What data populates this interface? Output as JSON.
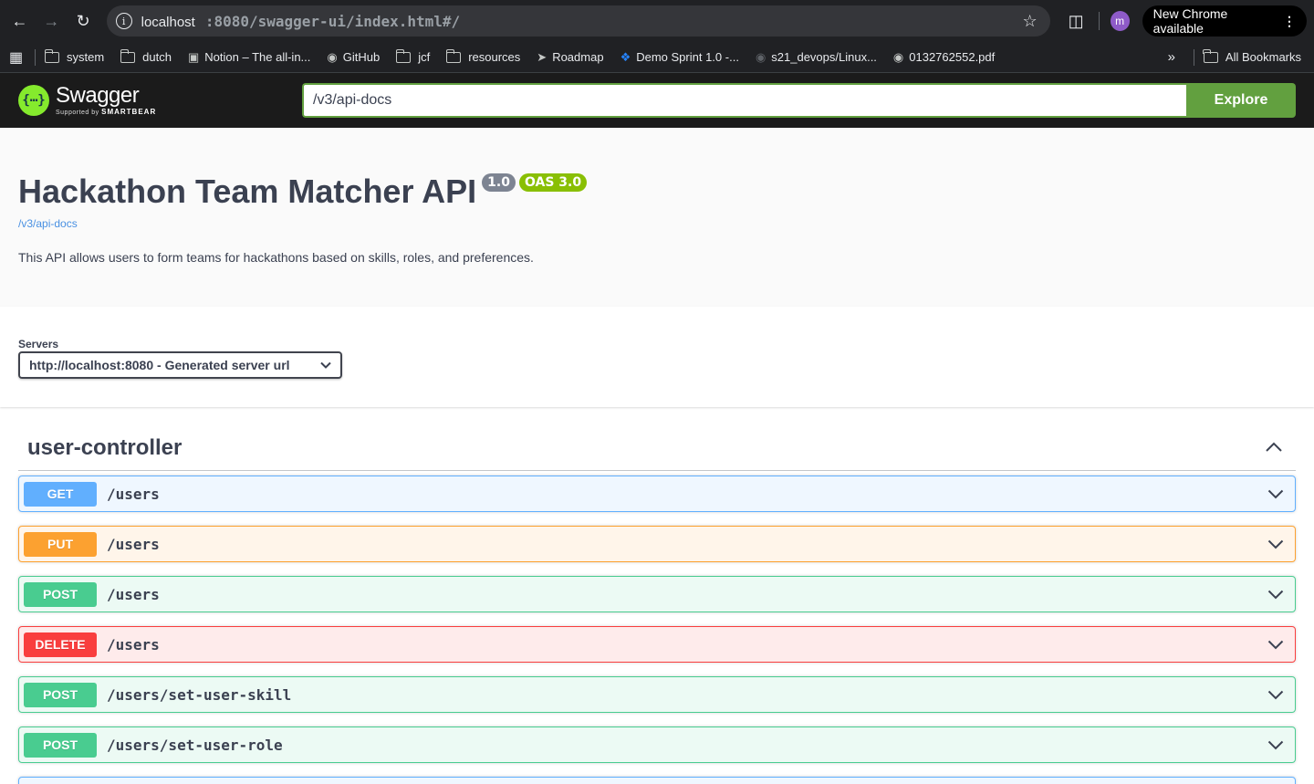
{
  "browser": {
    "url_host": "localhost",
    "url_path": ":8080/swagger-ui/index.html#/",
    "update_label": "New Chrome available",
    "profile_initial": "m"
  },
  "bookmarks": {
    "items": [
      {
        "label": "system",
        "icon": "folder-icon"
      },
      {
        "label": "dutch",
        "icon": "folder-icon"
      },
      {
        "label": "Notion – The all-in...",
        "icon": "notion-icon"
      },
      {
        "label": "GitHub",
        "icon": "github-icon"
      },
      {
        "label": "jcf",
        "icon": "folder-icon"
      },
      {
        "label": "resources",
        "icon": "folder-icon"
      },
      {
        "label": "Roadmap",
        "icon": "rocket-icon"
      },
      {
        "label": "Demo Sprint 1.0 -...",
        "icon": "jira-icon"
      },
      {
        "label": "s21_devops/Linux...",
        "icon": "github-icon"
      },
      {
        "label": "0132762552.pdf",
        "icon": "globe-icon"
      }
    ],
    "all_label": "All Bookmarks"
  },
  "topbar": {
    "logo_text": "Swagger",
    "logo_sub": "Supported by",
    "logo_brand": "SMARTBEAR",
    "search_value": "/v3/api-docs",
    "explore_label": "Explore"
  },
  "info": {
    "title": "Hackathon Team Matcher API",
    "version": "1.0",
    "oas": "OAS 3.0",
    "doc_link": "/v3/api-docs",
    "description": "This API allows users to form teams for hackathons based on skills, roles, and preferences."
  },
  "servers": {
    "label": "Servers",
    "selected": "http://localhost:8080 - Generated server url"
  },
  "tag": {
    "name": "user-controller"
  },
  "colors": {
    "get": "#61affe",
    "put": "#fca130",
    "post": "#49cc90",
    "delete": "#f93e3e"
  },
  "operations": [
    {
      "method": "GET",
      "path": "/users"
    },
    {
      "method": "PUT",
      "path": "/users"
    },
    {
      "method": "POST",
      "path": "/users"
    },
    {
      "method": "DELETE",
      "path": "/users"
    },
    {
      "method": "POST",
      "path": "/users/set-user-skill"
    },
    {
      "method": "POST",
      "path": "/users/set-user-role"
    }
  ]
}
